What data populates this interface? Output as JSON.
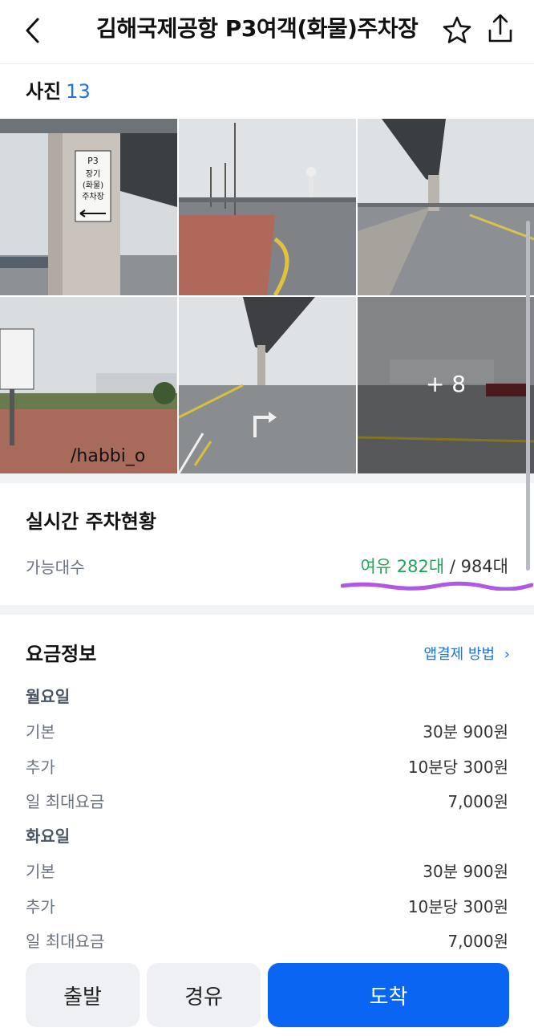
{
  "header": {
    "title": "김해국제공항 P3여객(화물)주차장",
    "icons": [
      "back-icon",
      "star-icon",
      "share-icon"
    ]
  },
  "photos": {
    "label": "사진",
    "count": "13",
    "more_label": "+ 8",
    "sign_text": [
      "P3",
      "장기",
      "(화물)",
      "주차장"
    ],
    "watermark": "/habbi_o"
  },
  "realtime": {
    "title": "실시간 주차현황",
    "available_label": "가능대수",
    "available_value": "여유 282대",
    "total_value": " / 984대"
  },
  "fee": {
    "title": "요금정보",
    "app_payment_link": "앱결제 방법",
    "days": [
      {
        "day": "월요일",
        "rows": [
          {
            "label": "기본",
            "value": "30분 900원"
          },
          {
            "label": "추가",
            "value": "10분당 300원"
          },
          {
            "label": "일 최대요금",
            "value": "7,000원"
          }
        ]
      },
      {
        "day": "화요일",
        "rows": [
          {
            "label": "기본",
            "value": "30분 900원"
          },
          {
            "label": "추가",
            "value": "10분당 300원"
          },
          {
            "label": "일 최대요금",
            "value": "7,000원"
          }
        ]
      }
    ]
  },
  "actions": {
    "depart": "출발",
    "via": "경유",
    "arrive": "도착"
  },
  "colors": {
    "accent": "#0a66f2",
    "available": "#22a35a",
    "link": "#1a73e8"
  }
}
